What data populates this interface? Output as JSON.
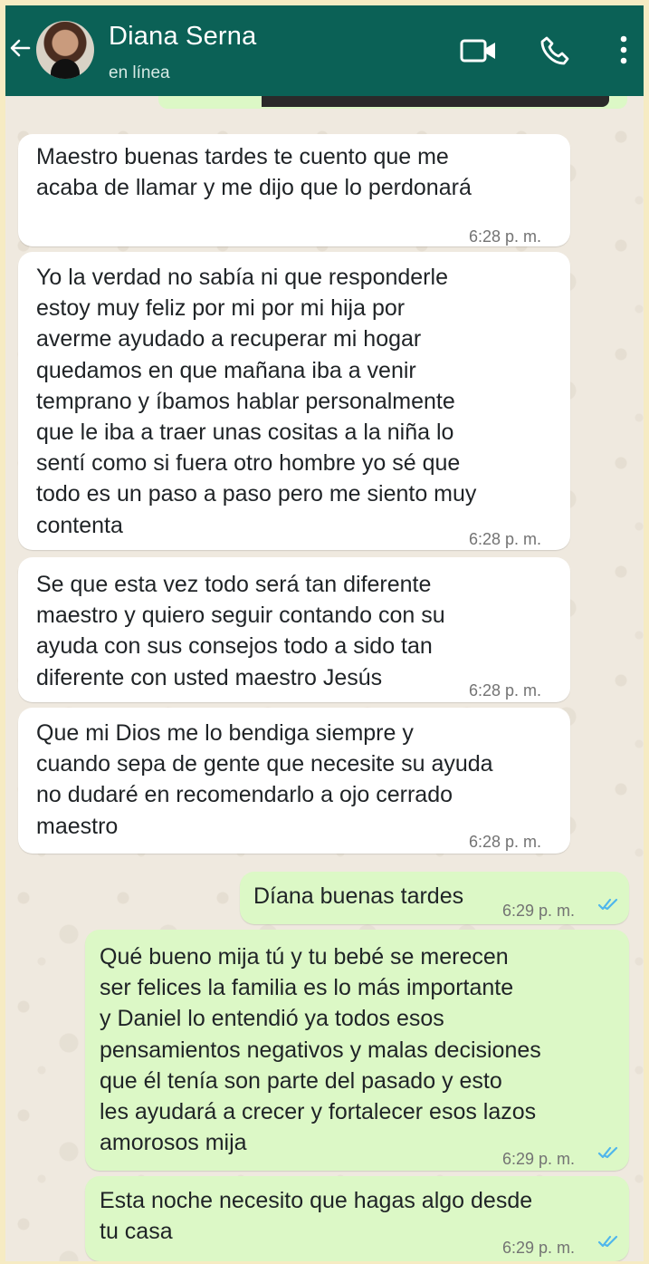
{
  "header": {
    "contact_name": "Diana Serna",
    "status": "en línea",
    "icons": [
      "back-arrow-icon",
      "avatar",
      "video-call-icon",
      "phone-icon",
      "more-options-icon"
    ]
  },
  "colors": {
    "header": "#0b6156",
    "incoming_bubble": "#ffffff",
    "outgoing_bubble": "#dcf8c6",
    "read_ticks": "#4fb6ec",
    "outer_border": "#f6ebc3"
  },
  "messages": [
    {
      "direction": "incoming",
      "text": "Maestro buenas tardes te cuento que me\nacaba de llamar y me dijo que lo perdonará",
      "time": "6:28 p. m."
    },
    {
      "direction": "incoming",
      "text": "Yo la verdad no sabía ni que responderle\nestoy muy feliz por mi por mi hija por\naverme ayudado a recuperar mi hogar\nquedamos en que mañana iba a venir\ntemprano y íbamos hablar personalmente\nque le iba a traer unas cositas a la niña lo\nsentí como si fuera otro hombre yo sé que\ntodo es un paso a paso pero me siento muy\ncontenta",
      "time": "6:28 p. m."
    },
    {
      "direction": "incoming",
      "text": "Se que esta vez todo será tan diferente\nmaestro y quiero seguir contando con su\nayuda con sus consejos todo a sido tan\ndiferente con usted maestro Jesús",
      "time": "6:28 p. m."
    },
    {
      "direction": "incoming",
      "text": "Que mi Dios me lo bendiga siempre y\ncuando sepa de gente que necesite su ayuda\nno dudaré en recomendarlo a ojo cerrado\nmaestro",
      "time": "6:28 p. m."
    },
    {
      "direction": "outgoing",
      "text": "Díana buenas tardes",
      "time": "6:29 p. m.",
      "status": "read"
    },
    {
      "direction": "outgoing",
      "text": "Qué bueno mija tú y tu bebé se merecen\nser felices la familia es lo más importante\ny Daniel lo entendió ya todos esos\npensamientos negativos y malas decisiones\nque él tenía son parte del pasado y esto\nles ayudará a crecer y fortalecer esos lazos\namorosos mija",
      "time": "6:29 p. m.",
      "status": "read"
    },
    {
      "direction": "outgoing",
      "text": "Esta noche necesito que hagas algo desde\ntu casa",
      "time": "6:29 p. m.",
      "status": "read"
    }
  ]
}
